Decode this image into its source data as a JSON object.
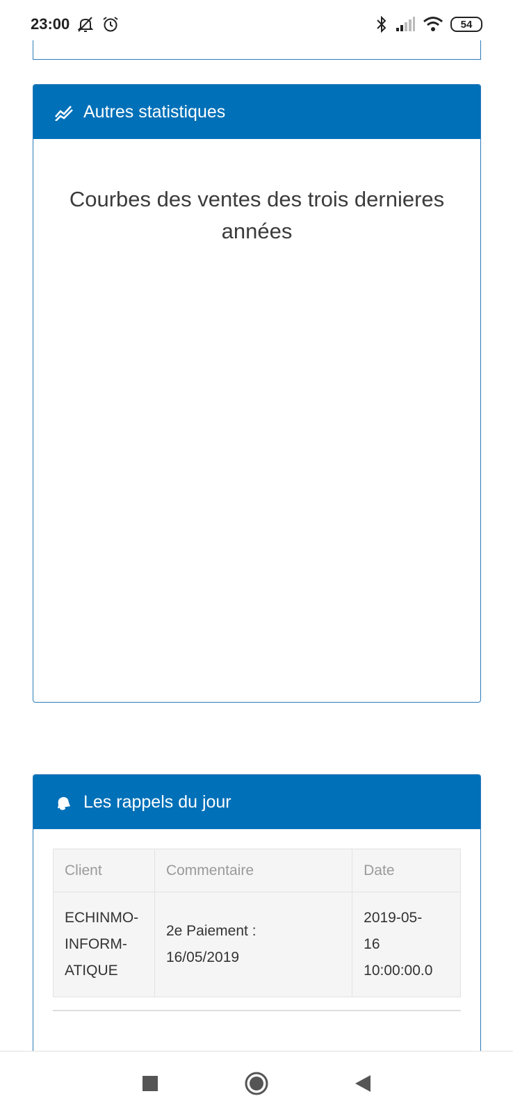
{
  "status_bar": {
    "time": "23:00",
    "battery": "54",
    "icons": [
      "muted-bell-icon",
      "alarm-icon",
      "bluetooth-icon",
      "signal-icon",
      "wifi-icon",
      "battery-icon"
    ]
  },
  "stats_panel": {
    "icon": "chart-line-icon",
    "title": "Autres statistiques",
    "chart_title": "Courbes des ventes des trois dernieres années"
  },
  "reminders_panel": {
    "icon": "bell-icon",
    "title": "Les rappels du jour",
    "columns": [
      "Client",
      "Commentaire",
      "Date"
    ],
    "rows": [
      {
        "client": "ECHINMO-INFORM-ATIQUE",
        "client_lines": [
          "ECHINMO-",
          "INFORM-",
          "ATIQUE"
        ],
        "commentaire": "2e Paiement : 16/05/2019",
        "commentaire_lines": [
          "2e Paiement :",
          "16/05/2019"
        ],
        "date": "2019-05-16 10:00:00.0",
        "date_lines": [
          "2019-05-",
          "16",
          "10:00:00.0"
        ]
      }
    ]
  },
  "nav_bar": {
    "icons": [
      "recent-apps-icon",
      "home-icon",
      "back-icon"
    ]
  },
  "colors": {
    "header_blue": "#0070b8",
    "border_blue": "#2a7ab8"
  }
}
